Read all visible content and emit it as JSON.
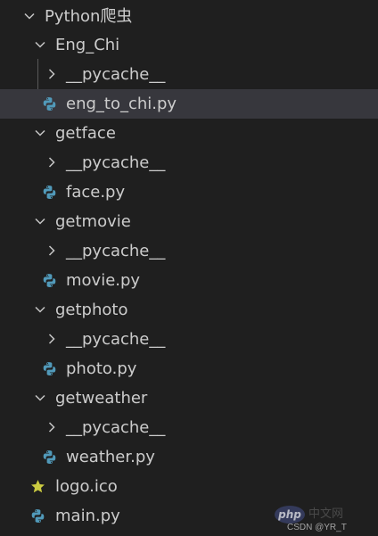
{
  "explorer": {
    "root": {
      "label": "Python爬虫",
      "expanded": true
    },
    "items": [
      {
        "label": "Eng_Chi",
        "type": "folder",
        "expanded": true
      },
      {
        "label": "__pycache__",
        "type": "folder",
        "expanded": false
      },
      {
        "label": "eng_to_chi.py",
        "type": "file",
        "icon": "python-file-icon",
        "selected": true
      },
      {
        "label": "getface",
        "type": "folder",
        "expanded": true
      },
      {
        "label": "__pycache__",
        "type": "folder",
        "expanded": false
      },
      {
        "label": "face.py",
        "type": "file",
        "icon": "python-file-icon"
      },
      {
        "label": "getmovie",
        "type": "folder",
        "expanded": true
      },
      {
        "label": "__pycache__",
        "type": "folder",
        "expanded": false
      },
      {
        "label": "movie.py",
        "type": "file",
        "icon": "python-file-icon"
      },
      {
        "label": "getphoto",
        "type": "folder",
        "expanded": true
      },
      {
        "label": "__pycache__",
        "type": "folder",
        "expanded": false
      },
      {
        "label": "photo.py",
        "type": "file",
        "icon": "python-file-icon"
      },
      {
        "label": "getweather",
        "type": "folder",
        "expanded": true
      },
      {
        "label": "__pycache__",
        "type": "folder",
        "expanded": false
      },
      {
        "label": "weather.py",
        "type": "file",
        "icon": "python-file-icon"
      },
      {
        "label": "logo.ico",
        "type": "file",
        "icon": "star-icon"
      },
      {
        "label": "main.py",
        "type": "file",
        "icon": "python-file-icon"
      }
    ]
  },
  "watermark": {
    "badge": "php",
    "site": "中文网",
    "credit": "CSDN @YR_T"
  },
  "colors": {
    "background": "#1f1f1f",
    "selected_row": "#37373d",
    "text": "#cccccc",
    "python_icon": "#519aba",
    "star_icon": "#cbcb41",
    "chevron": "#c5c5c5"
  }
}
